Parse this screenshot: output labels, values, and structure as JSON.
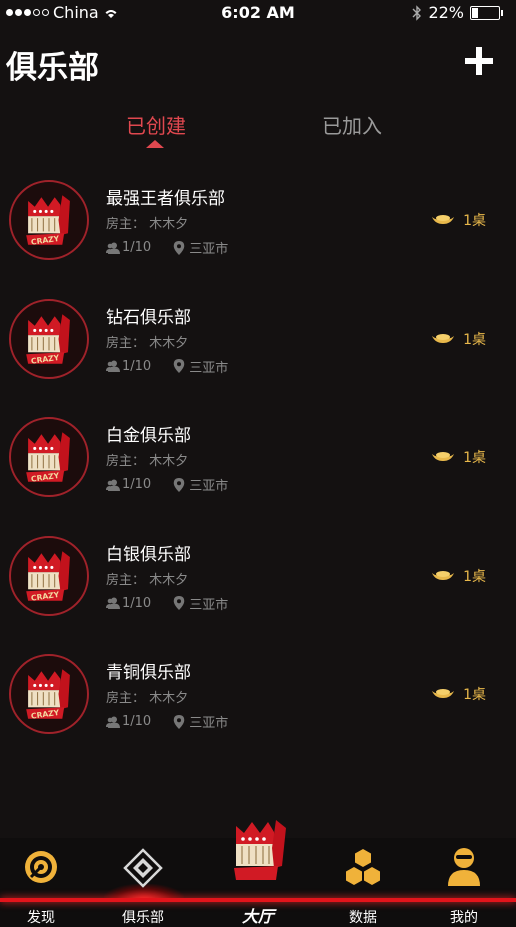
{
  "status": {
    "carrier": "China",
    "time": "6:02 AM",
    "battery": "22%"
  },
  "header": {
    "title": "俱乐部",
    "add_icon": "plus-icon"
  },
  "tabs": [
    {
      "label": "已创建",
      "active": true
    },
    {
      "label": "已加入",
      "active": false
    }
  ],
  "clubs": [
    {
      "name": "最强王者俱乐部",
      "owner": "房主：  木木夕",
      "members": "1/10",
      "city": "三亚市",
      "tables": "1桌"
    },
    {
      "name": "钻石俱乐部",
      "owner": "房主：  木木夕",
      "members": "1/10",
      "city": "三亚市",
      "tables": "1桌"
    },
    {
      "name": "白金俱乐部",
      "owner": "房主：  木木夕",
      "members": "1/10",
      "city": "三亚市",
      "tables": "1桌"
    },
    {
      "name": "白银俱乐部",
      "owner": "房主：  木木夕",
      "members": "1/10",
      "city": "三亚市",
      "tables": "1桌"
    },
    {
      "name": "青铜俱乐部",
      "owner": "房主：  木木夕",
      "members": "1/10",
      "city": "三亚市",
      "tables": "1桌"
    }
  ],
  "avatar_text": "CRAZY",
  "nav": {
    "discover": "发现",
    "club": "俱乐部",
    "hall": "大厅",
    "data": "数据",
    "mine": "我的"
  },
  "colors": {
    "accent": "#e0484f",
    "gold": "#e8b84b",
    "nav_red": "#e3141b",
    "background": "#141111"
  }
}
